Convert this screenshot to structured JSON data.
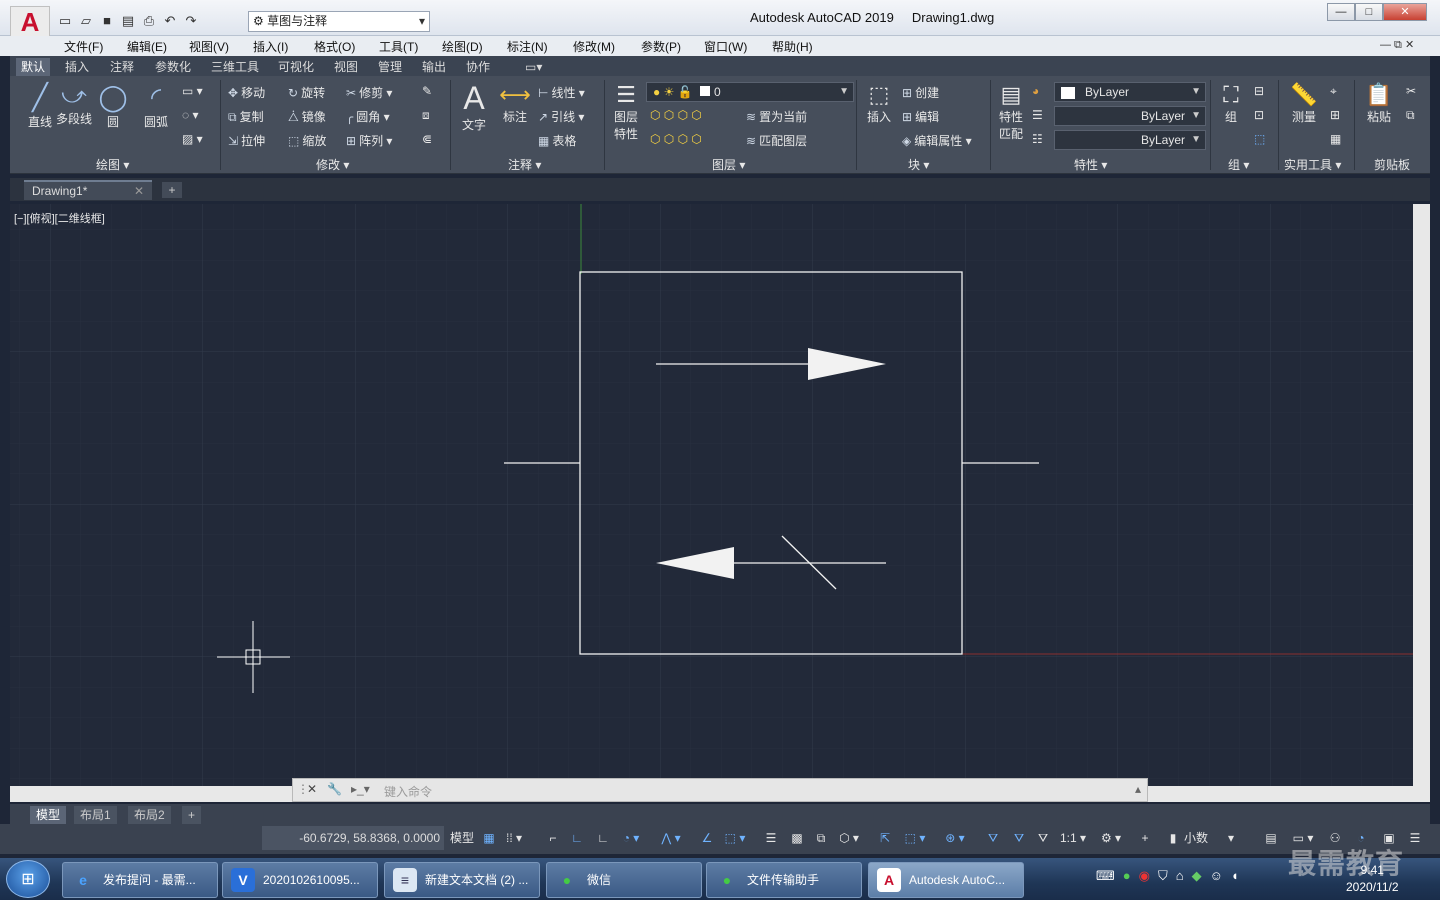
{
  "app": {
    "title": "Autodesk AutoCAD 2019",
    "file": "Drawing1.dwg",
    "workspace": "草图与注释",
    "logo": "A"
  },
  "window_buttons": {
    "minimize": "—",
    "maximize": "□",
    "close": "✕"
  },
  "menu": [
    "文件(F)",
    "编辑(E)",
    "视图(V)",
    "插入(I)",
    "格式(O)",
    "工具(T)",
    "绘图(D)",
    "标注(N)",
    "修改(M)",
    "参数(P)",
    "窗口(W)",
    "帮助(H)"
  ],
  "ribbon_tabs": [
    "默认",
    "插入",
    "注释",
    "参数化",
    "三维工具",
    "可视化",
    "视图",
    "管理",
    "输出",
    "协作"
  ],
  "panels": {
    "draw": "绘图",
    "modify": "修改",
    "annotate": "注释",
    "layers": "图层",
    "block": "块",
    "properties": "特性",
    "groups": "组",
    "utilities": "实用工具",
    "clipboard": "剪贴板"
  },
  "draw_tools": {
    "line": "直线",
    "polyline": "多段线",
    "circle": "圆",
    "arc": "圆弧"
  },
  "modify_tools": {
    "move": "移动",
    "rotate": "旋转",
    "trim": "修剪",
    "copy": "复制",
    "mirror": "镜像",
    "fillet": "圆角",
    "stretch": "拉伸",
    "scale": "缩放",
    "array": "阵列"
  },
  "annotate_tools": {
    "text": "文字",
    "dimension": "标注",
    "linear": "线性",
    "leader": "引线",
    "table": "表格"
  },
  "layer_tools": {
    "layer_props_1": "图层",
    "layer_props_2": "特性",
    "current_layer": "0",
    "set_current": "置为当前",
    "match_layer": "匹配图层"
  },
  "block_tools": {
    "insert": "插入",
    "create": "创建",
    "edit": "编辑",
    "edit_attr": "编辑属性"
  },
  "property_tools": {
    "match_1": "特性",
    "match_2": "匹配",
    "color": "ByLayer",
    "linetype": "ByLayer",
    "lineweight": "ByLayer"
  },
  "group_tools": {
    "group": "组"
  },
  "utility_tools": {
    "measure": "测量"
  },
  "clipboard_tools": {
    "paste": "粘贴"
  },
  "doc_tab": "Drawing1*",
  "viewport_label": "[−][俯视][二维线框]",
  "command_placeholder": "键入命令",
  "layout_tabs": [
    "模型",
    "布局1",
    "布局2"
  ],
  "status": {
    "coords": "-60.6729, 58.8368, 0.0000",
    "model": "模型",
    "scale": "1:1",
    "units": "小数"
  },
  "taskbar": [
    {
      "label": "发布提问 - 最需...",
      "icon": "e"
    },
    {
      "label": "2020102610095...",
      "icon": "V"
    },
    {
      "label": "新建文本文档 (2) ...",
      "icon": "≡"
    },
    {
      "label": "微信",
      "icon": "●"
    },
    {
      "label": "文件传输助手",
      "icon": "●"
    },
    {
      "label": "Autodesk AutoC...",
      "icon": "A"
    }
  ],
  "clock": {
    "time": "9:41",
    "date": "2020/11/2"
  },
  "watermark": "最需教育",
  "colors": {
    "canvas": "#222939",
    "accent": "#c8102e",
    "ribbon": "#464e5b"
  }
}
